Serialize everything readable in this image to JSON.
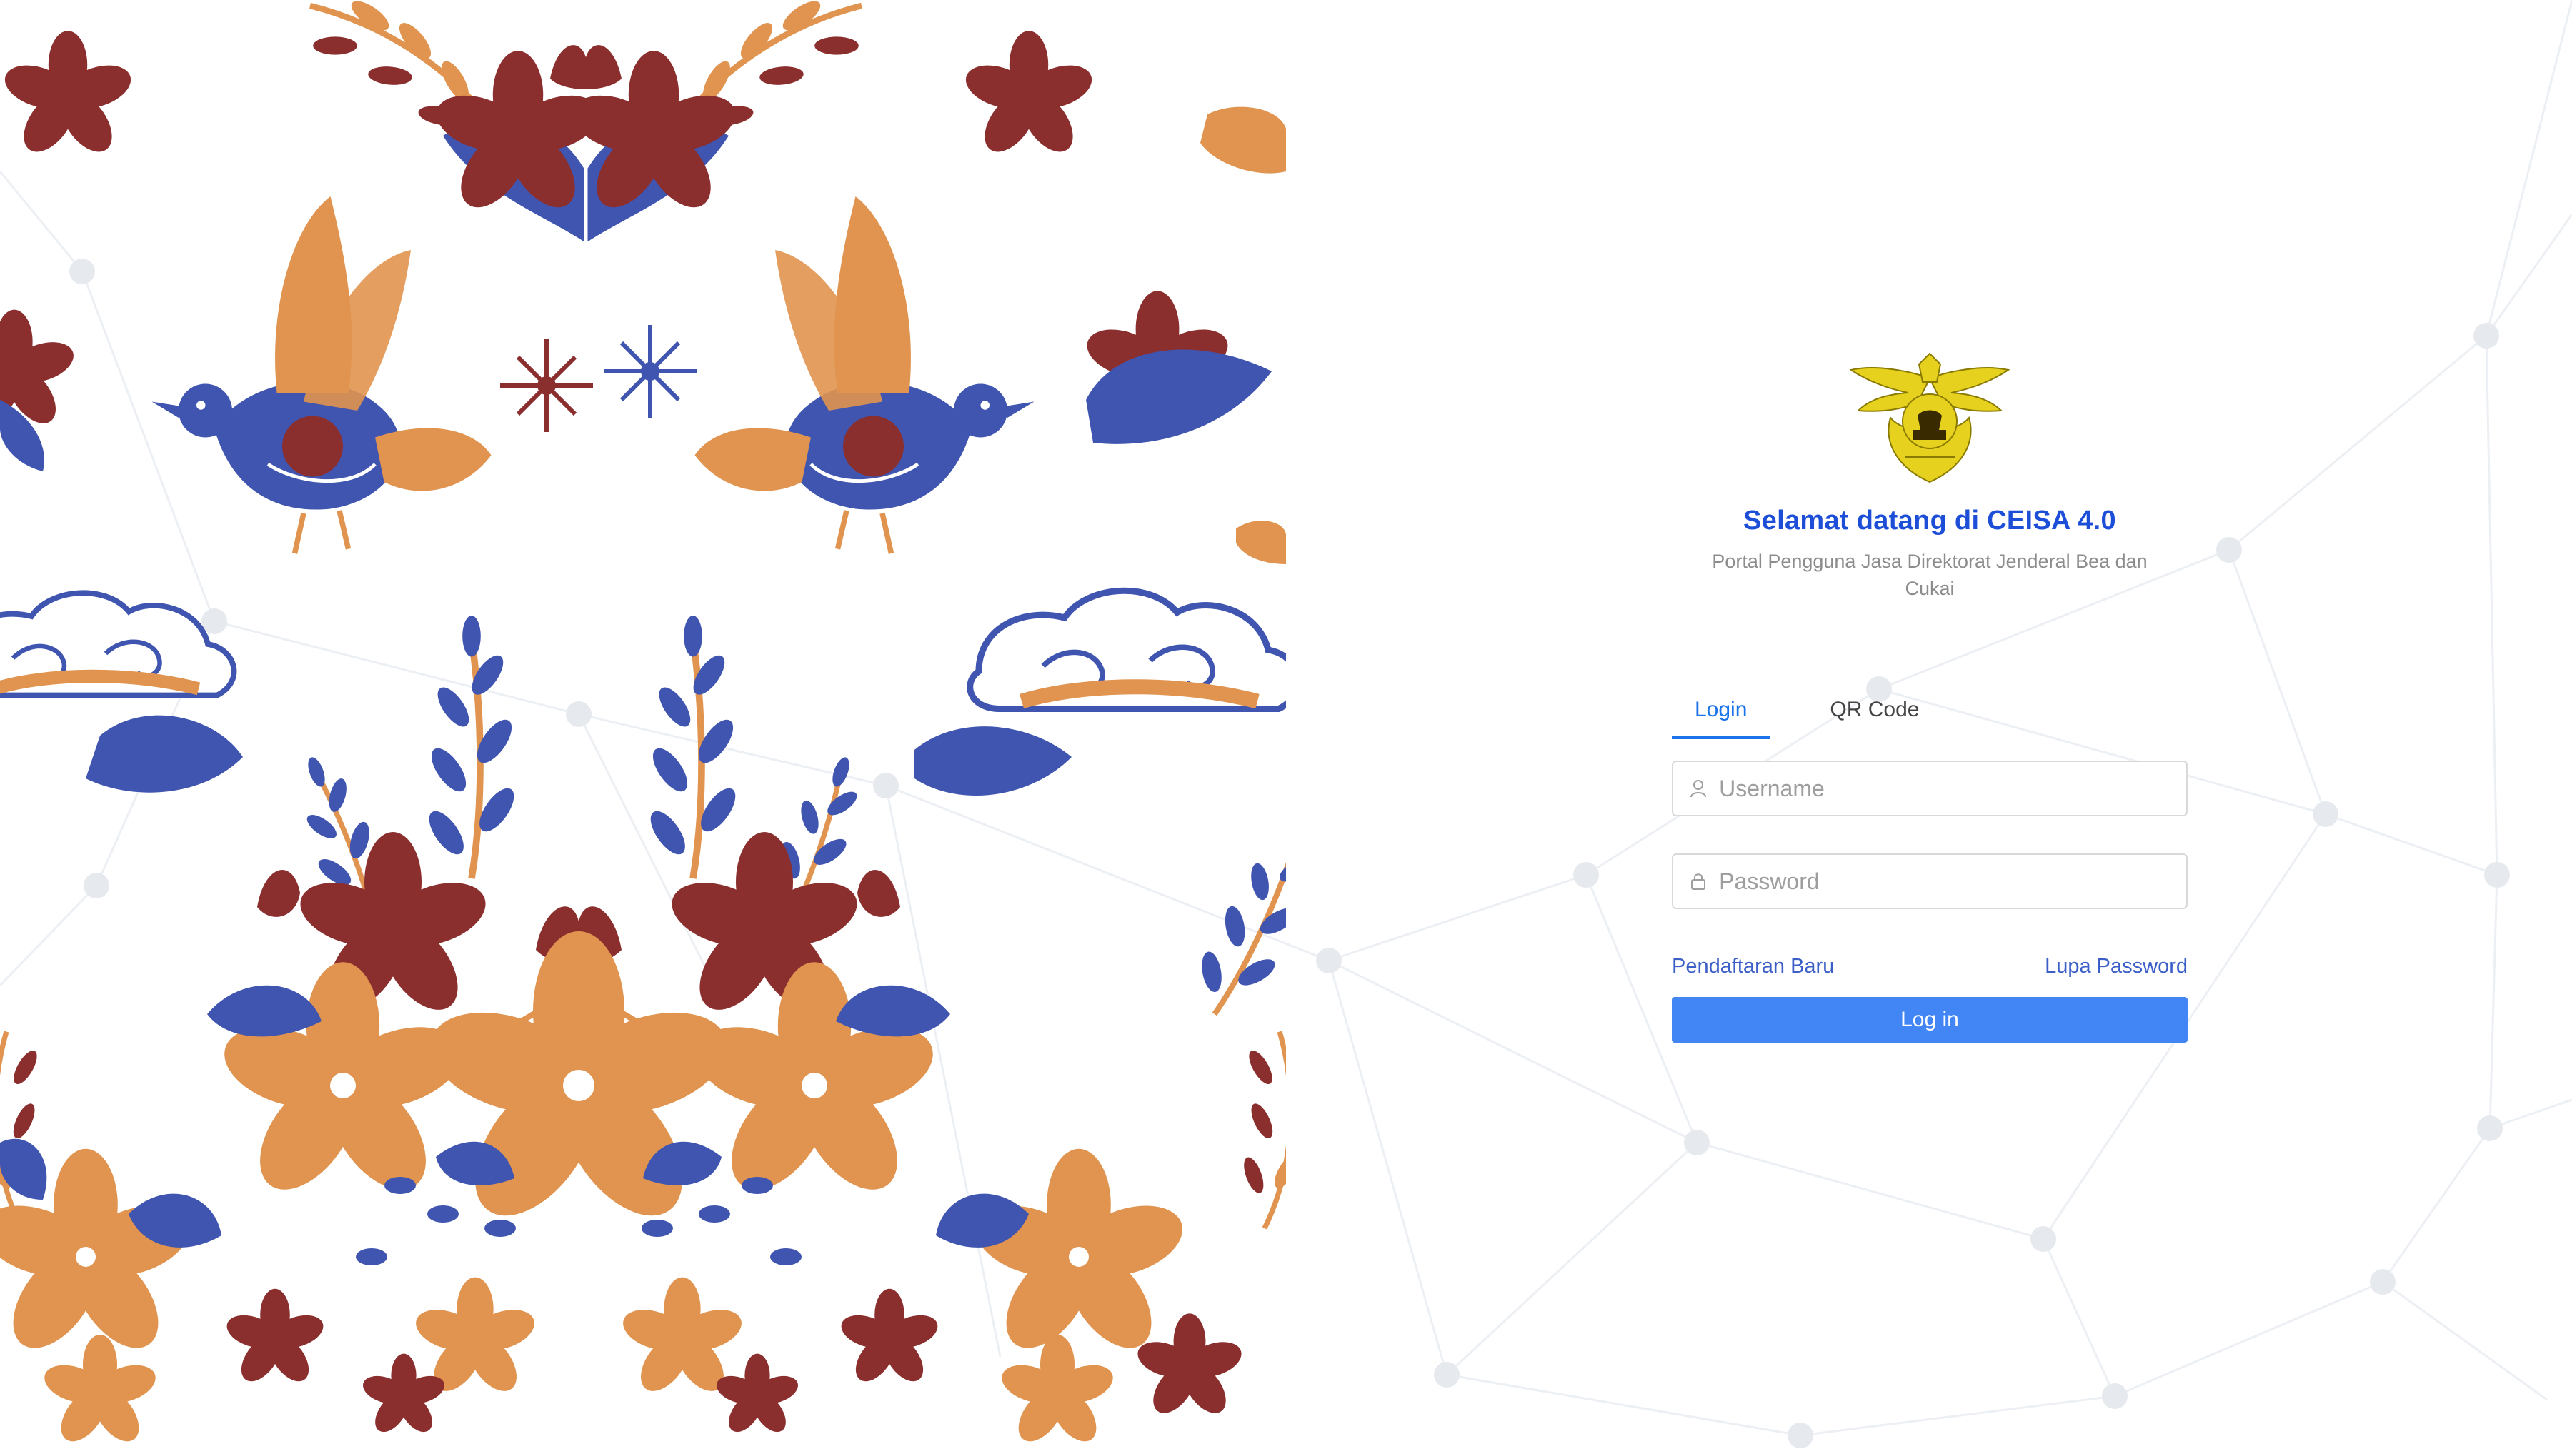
{
  "login": {
    "title": "Selamat datang di CEISA 4.0",
    "subtitle": "Portal Pengguna Jasa Direktorat Jenderal Bea dan Cukai",
    "tabs": [
      {
        "label": "Login",
        "active": true
      },
      {
        "label": "QR Code",
        "active": false
      }
    ],
    "username": {
      "placeholder": "Username",
      "value": "",
      "icon": "user-icon"
    },
    "password": {
      "placeholder": "Password",
      "value": "",
      "icon": "lock-icon"
    },
    "register_link": "Pendaftaran Baru",
    "forgot_link": "Lupa Password",
    "submit_label": "Log in"
  },
  "colors": {
    "title": "#1d4ed8",
    "link": "#3b5fc7",
    "button": "#4285f4",
    "tab_active": "#1a73e8",
    "batik_red": "#8b2e2e",
    "batik_blue": "#3f55b0",
    "batik_orange": "#e0944f"
  }
}
